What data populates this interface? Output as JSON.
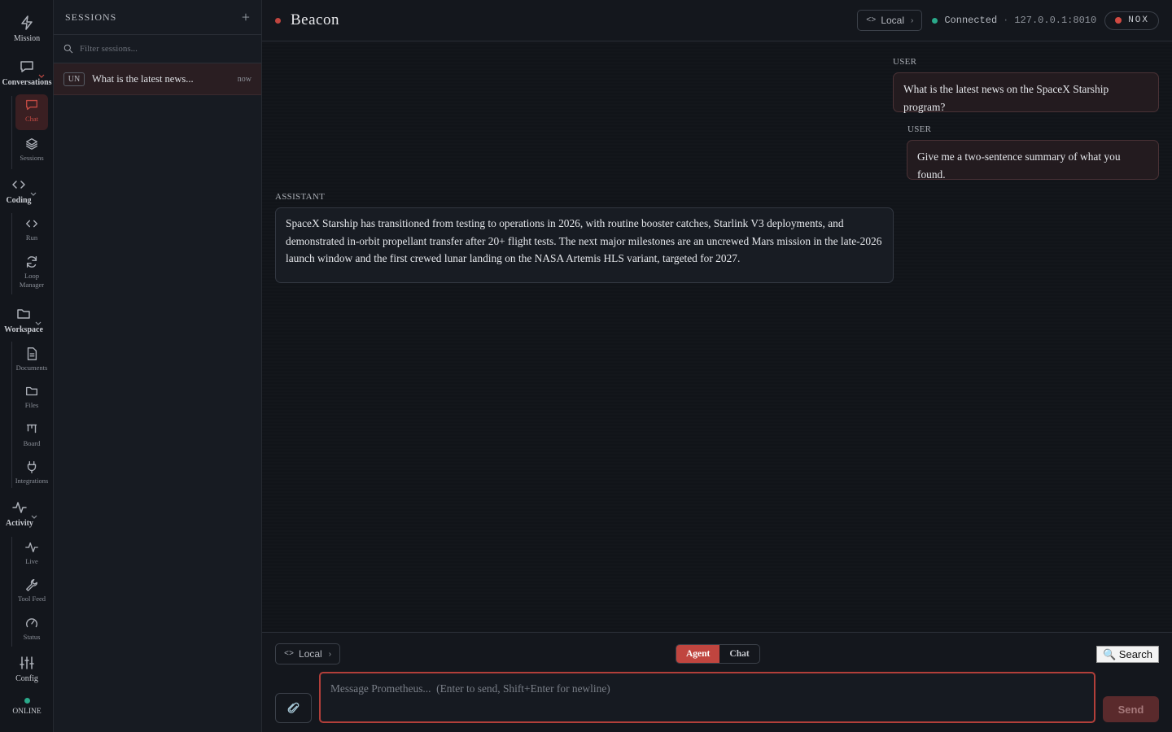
{
  "rail": {
    "mission": "Mission",
    "conversations": "Conversations",
    "chat": "Chat",
    "sessions": "Sessions",
    "coding": "Coding",
    "run": "Run",
    "loop_manager": "Loop Manager",
    "workspace": "Workspace",
    "documents": "Documents",
    "files": "Files",
    "board": "Board",
    "integrations": "Integrations",
    "activity": "Activity",
    "live": "Live",
    "tool_feed": "Tool Feed",
    "status": "Status",
    "config": "Config",
    "online": "ONLINE"
  },
  "sessions_panel": {
    "title": "SESSIONS",
    "add": "+",
    "filter_placeholder": "Filter sessions...",
    "items": [
      {
        "badge": "UN",
        "name": "What is the latest news...",
        "time": "now"
      }
    ]
  },
  "header": {
    "title": "Beacon",
    "env_label": "Local",
    "status": "Connected",
    "separator": "·",
    "address": "127.0.0.1:8010",
    "profile": "NOX"
  },
  "messages": [
    {
      "role": "USER",
      "text": "What is the latest news on the SpaceX Starship program?"
    },
    {
      "role": "USER",
      "text": "Give me a two-sentence summary of what you found."
    },
    {
      "role": "ASSISTANT",
      "text": "SpaceX Starship has transitioned from testing to operations in 2026, with routine booster catches, Starlink V3 deployments, and demonstrated in-orbit propellant transfer after 20+ flight tests. The next major milestones are an uncrewed Mars mission in the late-2026 launch window and the first crewed lunar landing on the NASA Artemis HLS variant, targeted for 2027."
    }
  ],
  "composer": {
    "env_label": "Local",
    "mode_agent": "Agent",
    "mode_chat": "Chat",
    "search": "🔍 Search",
    "placeholder": "Message Prometheus...  (Enter to send, Shift+Enter for newline)",
    "send": "Send"
  },
  "colors": {
    "accent": "#c0453f",
    "online": "#2aa98a",
    "background": "#12151b"
  }
}
